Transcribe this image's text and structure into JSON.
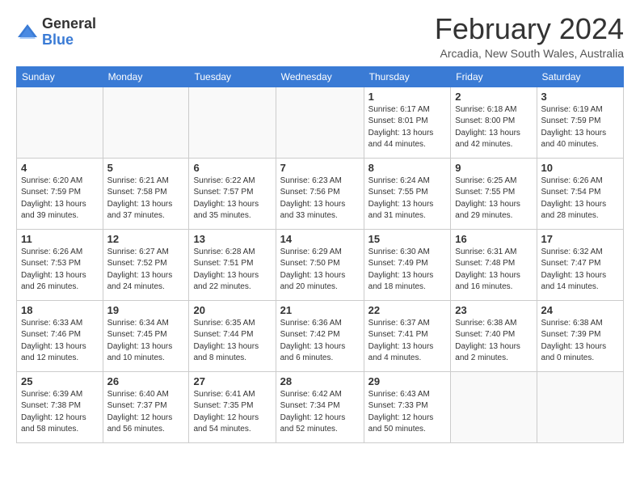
{
  "logo": {
    "general": "General",
    "blue": "Blue"
  },
  "title": "February 2024",
  "location": "Arcadia, New South Wales, Australia",
  "days_of_week": [
    "Sunday",
    "Monday",
    "Tuesday",
    "Wednesday",
    "Thursday",
    "Friday",
    "Saturday"
  ],
  "weeks": [
    [
      {
        "day": "",
        "info": ""
      },
      {
        "day": "",
        "info": ""
      },
      {
        "day": "",
        "info": ""
      },
      {
        "day": "",
        "info": ""
      },
      {
        "day": "1",
        "info": "Sunrise: 6:17 AM\nSunset: 8:01 PM\nDaylight: 13 hours\nand 44 minutes."
      },
      {
        "day": "2",
        "info": "Sunrise: 6:18 AM\nSunset: 8:00 PM\nDaylight: 13 hours\nand 42 minutes."
      },
      {
        "day": "3",
        "info": "Sunrise: 6:19 AM\nSunset: 7:59 PM\nDaylight: 13 hours\nand 40 minutes."
      }
    ],
    [
      {
        "day": "4",
        "info": "Sunrise: 6:20 AM\nSunset: 7:59 PM\nDaylight: 13 hours\nand 39 minutes."
      },
      {
        "day": "5",
        "info": "Sunrise: 6:21 AM\nSunset: 7:58 PM\nDaylight: 13 hours\nand 37 minutes."
      },
      {
        "day": "6",
        "info": "Sunrise: 6:22 AM\nSunset: 7:57 PM\nDaylight: 13 hours\nand 35 minutes."
      },
      {
        "day": "7",
        "info": "Sunrise: 6:23 AM\nSunset: 7:56 PM\nDaylight: 13 hours\nand 33 minutes."
      },
      {
        "day": "8",
        "info": "Sunrise: 6:24 AM\nSunset: 7:55 PM\nDaylight: 13 hours\nand 31 minutes."
      },
      {
        "day": "9",
        "info": "Sunrise: 6:25 AM\nSunset: 7:55 PM\nDaylight: 13 hours\nand 29 minutes."
      },
      {
        "day": "10",
        "info": "Sunrise: 6:26 AM\nSunset: 7:54 PM\nDaylight: 13 hours\nand 28 minutes."
      }
    ],
    [
      {
        "day": "11",
        "info": "Sunrise: 6:26 AM\nSunset: 7:53 PM\nDaylight: 13 hours\nand 26 minutes."
      },
      {
        "day": "12",
        "info": "Sunrise: 6:27 AM\nSunset: 7:52 PM\nDaylight: 13 hours\nand 24 minutes."
      },
      {
        "day": "13",
        "info": "Sunrise: 6:28 AM\nSunset: 7:51 PM\nDaylight: 13 hours\nand 22 minutes."
      },
      {
        "day": "14",
        "info": "Sunrise: 6:29 AM\nSunset: 7:50 PM\nDaylight: 13 hours\nand 20 minutes."
      },
      {
        "day": "15",
        "info": "Sunrise: 6:30 AM\nSunset: 7:49 PM\nDaylight: 13 hours\nand 18 minutes."
      },
      {
        "day": "16",
        "info": "Sunrise: 6:31 AM\nSunset: 7:48 PM\nDaylight: 13 hours\nand 16 minutes."
      },
      {
        "day": "17",
        "info": "Sunrise: 6:32 AM\nSunset: 7:47 PM\nDaylight: 13 hours\nand 14 minutes."
      }
    ],
    [
      {
        "day": "18",
        "info": "Sunrise: 6:33 AM\nSunset: 7:46 PM\nDaylight: 13 hours\nand 12 minutes."
      },
      {
        "day": "19",
        "info": "Sunrise: 6:34 AM\nSunset: 7:45 PM\nDaylight: 13 hours\nand 10 minutes."
      },
      {
        "day": "20",
        "info": "Sunrise: 6:35 AM\nSunset: 7:44 PM\nDaylight: 13 hours\nand 8 minutes."
      },
      {
        "day": "21",
        "info": "Sunrise: 6:36 AM\nSunset: 7:42 PM\nDaylight: 13 hours\nand 6 minutes."
      },
      {
        "day": "22",
        "info": "Sunrise: 6:37 AM\nSunset: 7:41 PM\nDaylight: 13 hours\nand 4 minutes."
      },
      {
        "day": "23",
        "info": "Sunrise: 6:38 AM\nSunset: 7:40 PM\nDaylight: 13 hours\nand 2 minutes."
      },
      {
        "day": "24",
        "info": "Sunrise: 6:38 AM\nSunset: 7:39 PM\nDaylight: 13 hours\nand 0 minutes."
      }
    ],
    [
      {
        "day": "25",
        "info": "Sunrise: 6:39 AM\nSunset: 7:38 PM\nDaylight: 12 hours\nand 58 minutes."
      },
      {
        "day": "26",
        "info": "Sunrise: 6:40 AM\nSunset: 7:37 PM\nDaylight: 12 hours\nand 56 minutes."
      },
      {
        "day": "27",
        "info": "Sunrise: 6:41 AM\nSunset: 7:35 PM\nDaylight: 12 hours\nand 54 minutes."
      },
      {
        "day": "28",
        "info": "Sunrise: 6:42 AM\nSunset: 7:34 PM\nDaylight: 12 hours\nand 52 minutes."
      },
      {
        "day": "29",
        "info": "Sunrise: 6:43 AM\nSunset: 7:33 PM\nDaylight: 12 hours\nand 50 minutes."
      },
      {
        "day": "",
        "info": ""
      },
      {
        "day": "",
        "info": ""
      }
    ]
  ]
}
